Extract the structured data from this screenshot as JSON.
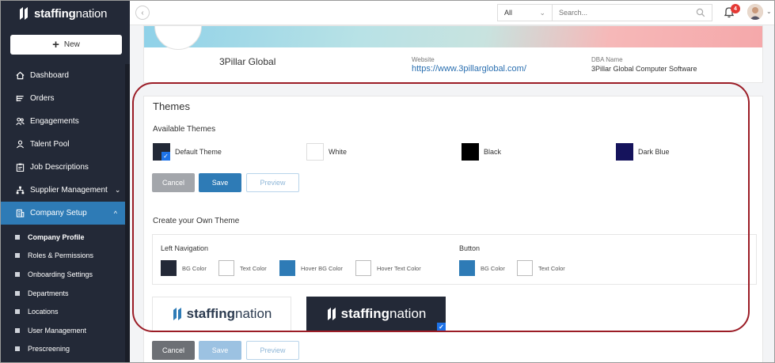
{
  "brand": {
    "name_bold": "staffing",
    "name_light": "nation"
  },
  "sidebar": {
    "new_label": "New",
    "items": [
      {
        "label": "Dashboard",
        "icon": "home-icon"
      },
      {
        "label": "Orders",
        "icon": "list-icon"
      },
      {
        "label": "Engagements",
        "icon": "people-icon"
      },
      {
        "label": "Talent Pool",
        "icon": "person-icon"
      },
      {
        "label": "Job Descriptions",
        "icon": "clipboard-icon"
      },
      {
        "label": "Supplier Management",
        "icon": "org-chart-icon"
      },
      {
        "label": "Company Setup",
        "icon": "building-icon"
      }
    ],
    "sub_items": [
      "Company Profile",
      "Roles & Permissions",
      "Onboarding Settings",
      "Departments",
      "Locations",
      "User Management",
      "Prescreening"
    ]
  },
  "topbar": {
    "filter_value": "All",
    "search_placeholder": "Search...",
    "notification_count": "4"
  },
  "profile": {
    "company_name": "3Pillar Global",
    "website_label": "Website",
    "website_value": "https://www.3pillarglobal.com/",
    "dba_label": "DBA Name",
    "dba_value": "3Pillar Global Computer Software"
  },
  "themes": {
    "title": "Themes",
    "available_label": "Available Themes",
    "options": [
      {
        "label": "Default Theme",
        "color": "#232937",
        "selected": true
      },
      {
        "label": "White",
        "color": "#ffffff",
        "selected": false
      },
      {
        "label": "Black",
        "color": "#000000",
        "selected": false
      },
      {
        "label": "Dark Blue",
        "color": "#15135c",
        "selected": false
      }
    ],
    "cancel_label": "Cancel",
    "save_label": "Save",
    "preview_label": "Preview",
    "own_title": "Create your Own Theme",
    "left_nav_label": "Left Navigation",
    "button_label": "Button",
    "left_nav_colors": [
      {
        "label": "BG Color",
        "color": "#232937"
      },
      {
        "label": "Text Color",
        "color": "#ffffff"
      },
      {
        "label": "Hover BG Color",
        "color": "#2e7bb6"
      },
      {
        "label": "Hover Text Color",
        "color": "#ffffff"
      }
    ],
    "button_colors": [
      {
        "label": "BG Color",
        "color": "#2e7bb6"
      },
      {
        "label": "Text Color",
        "color": "#ffffff"
      }
    ]
  },
  "colors": {
    "sidebar_bg": "#232937",
    "accent": "#2e7bb6",
    "annotation": "#9b1c26"
  }
}
